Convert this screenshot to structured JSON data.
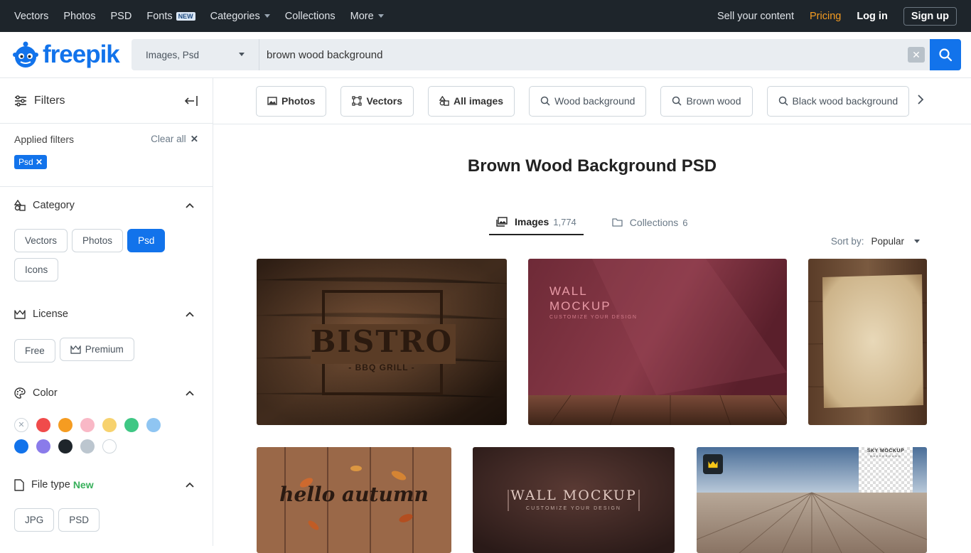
{
  "topnav": {
    "links": [
      "Vectors",
      "Photos",
      "PSD",
      "Fonts",
      "Categories",
      "Collections",
      "More"
    ],
    "fonts_badge": "NEW",
    "sell": "Sell your content",
    "pricing": "Pricing",
    "login": "Log in",
    "signup": "Sign up"
  },
  "header": {
    "logo": "freepik",
    "search_type": "Images, Psd",
    "search_value": "brown wood background"
  },
  "sidebar": {
    "title": "Filters",
    "applied_label": "Applied filters",
    "clear_all": "Clear all",
    "applied_chip": "Psd",
    "category": {
      "title": "Category",
      "options": [
        "Vectors",
        "Photos",
        "Psd",
        "Icons"
      ],
      "active": "Psd"
    },
    "license": {
      "title": "License",
      "options": [
        "Free",
        "Premium"
      ]
    },
    "color": {
      "title": "Color",
      "swatches": [
        "#ffffff",
        "#f04b4b",
        "#f59c21",
        "#f9b8c6",
        "#f7d26e",
        "#3fc784",
        "#8fc5f2",
        "#1273eb",
        "#8a7bea",
        "#1e252b",
        "#bcc6cf",
        "#ffffff"
      ]
    },
    "filetype": {
      "title": "File type",
      "new": "New",
      "options": [
        "JPG",
        "PSD"
      ]
    }
  },
  "main": {
    "tags": [
      {
        "label": "Photos",
        "icon": "image-icon"
      },
      {
        "label": "Vectors",
        "icon": "vector-icon"
      },
      {
        "label": "All images",
        "icon": "shapes-icon"
      },
      {
        "label": "Wood background",
        "icon": "search-icon"
      },
      {
        "label": "Brown wood",
        "icon": "search-icon"
      },
      {
        "label": "Black wood background",
        "icon": "search-icon"
      }
    ],
    "title": "Brown Wood Background PSD",
    "tabs": [
      {
        "label": "Images",
        "count": "1,774"
      },
      {
        "label": "Collections",
        "count": "6"
      }
    ],
    "sort_label": "Sort by:",
    "sort_value": "Popular",
    "thumbs": {
      "bistro_title": "BISTRO",
      "bistro_sub": "- BBQ GRILL -",
      "wall1_title": "WALL MOCKUP",
      "wall1_sub": "CUSTOMIZE YOUR DESIGN",
      "autumn_text": "hello autumn",
      "wall2_title": "WALL MOCKUP",
      "wall2_sub": "CUSTOMIZE YOUR DESIGN",
      "sky_title": "SKY MOCKUP",
      "sky_sub": "BACKGROUND"
    }
  }
}
